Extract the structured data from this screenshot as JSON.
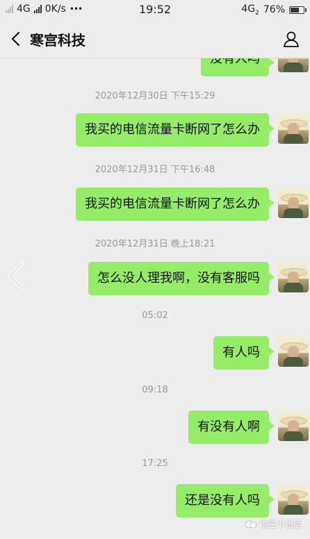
{
  "status_bar": {
    "network_left": "4G",
    "speed": "0K/s",
    "clock": "19:52",
    "network_right": "4G",
    "sim_index": "2",
    "battery_percent": "76%",
    "battery_level": 0.76
  },
  "header": {
    "title": "寒宫科技"
  },
  "messages": [
    {
      "type": "text",
      "text": "没有人吗",
      "partial": true
    },
    {
      "type": "time",
      "text": "2020年12月30日 下午15:29"
    },
    {
      "type": "text",
      "text": "我买的电信流量卡断网了怎么办"
    },
    {
      "type": "time",
      "text": "2020年12月31日 下午16:48"
    },
    {
      "type": "text",
      "text": "我买的电信流量卡断网了怎么办"
    },
    {
      "type": "time",
      "text": "2020年12月31日 晚上18:21"
    },
    {
      "type": "text",
      "text": "怎么没人理我啊，没有客服吗"
    },
    {
      "type": "time",
      "text": "05:02"
    },
    {
      "type": "text",
      "text": "有人吗"
    },
    {
      "type": "time",
      "text": "09:18"
    },
    {
      "type": "text",
      "text": "有没有人啊"
    },
    {
      "type": "time",
      "text": "17:25"
    },
    {
      "type": "text",
      "text": "还是没有人吗"
    }
  ],
  "watermark": {
    "text": "流量卡售后"
  },
  "colors": {
    "bubble": "#95ec69",
    "background": "#ededed",
    "timestamp": "#9a9a9a"
  },
  "icons": {
    "back": "back-icon",
    "profile": "profile-icon",
    "side_nav": "chevron-left-icon",
    "watermark": "wechat-icon"
  }
}
